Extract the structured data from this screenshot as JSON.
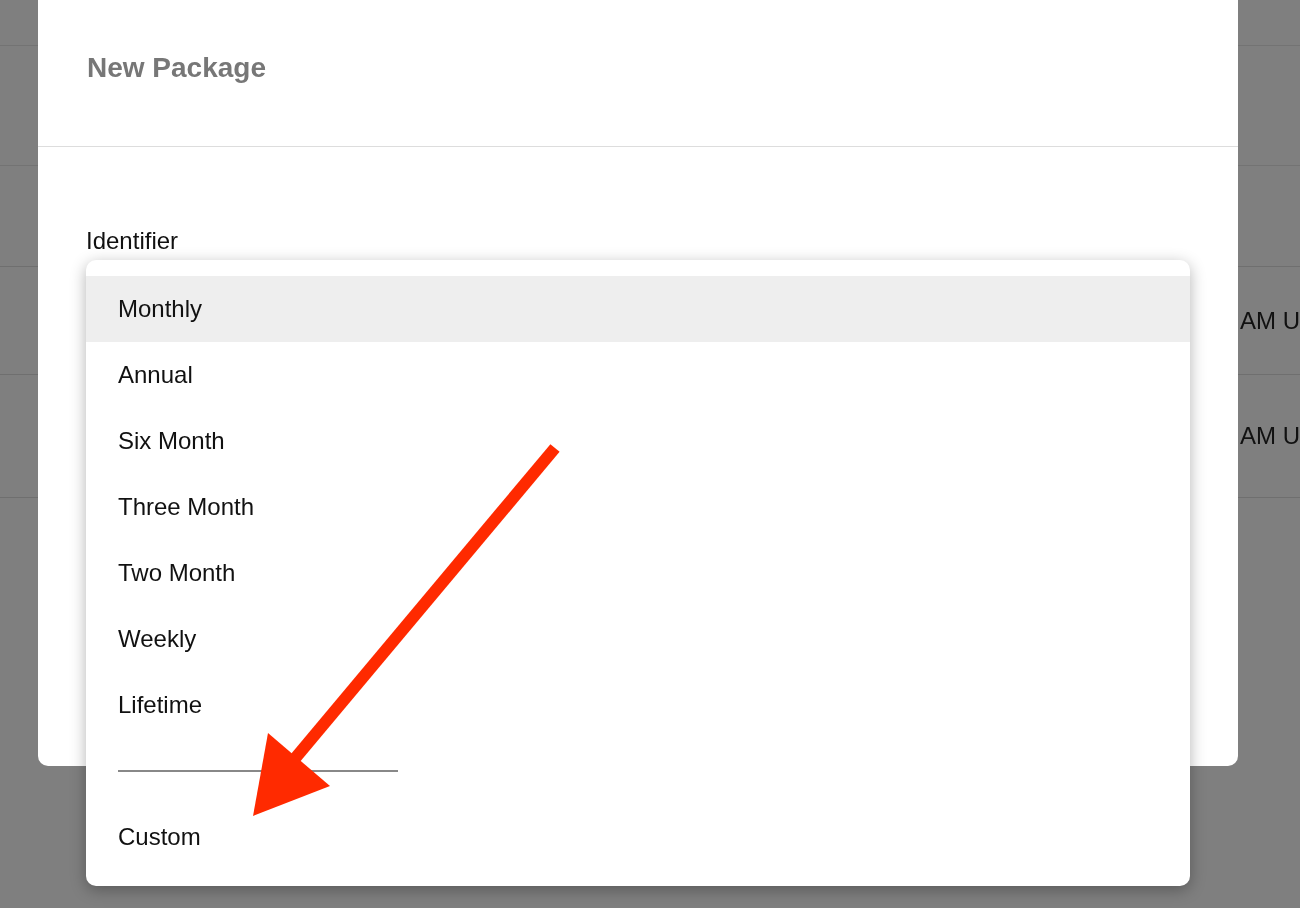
{
  "background_table": {
    "rows": [
      {
        "cell": "AM U"
      },
      {
        "cell": "AM U"
      }
    ]
  },
  "dialog": {
    "title": "New Package",
    "field_label": "Identifier"
  },
  "dropdown": {
    "items": [
      {
        "kind": "option",
        "label": "Monthly",
        "selected": true
      },
      {
        "kind": "option",
        "label": "Annual",
        "selected": false
      },
      {
        "kind": "option",
        "label": "Six Month",
        "selected": false
      },
      {
        "kind": "option",
        "label": "Three Month",
        "selected": false
      },
      {
        "kind": "option",
        "label": "Two Month",
        "selected": false
      },
      {
        "kind": "option",
        "label": "Weekly",
        "selected": false
      },
      {
        "kind": "option",
        "label": "Lifetime",
        "selected": false
      },
      {
        "kind": "separator"
      },
      {
        "kind": "option",
        "label": "Custom",
        "selected": false
      }
    ]
  }
}
